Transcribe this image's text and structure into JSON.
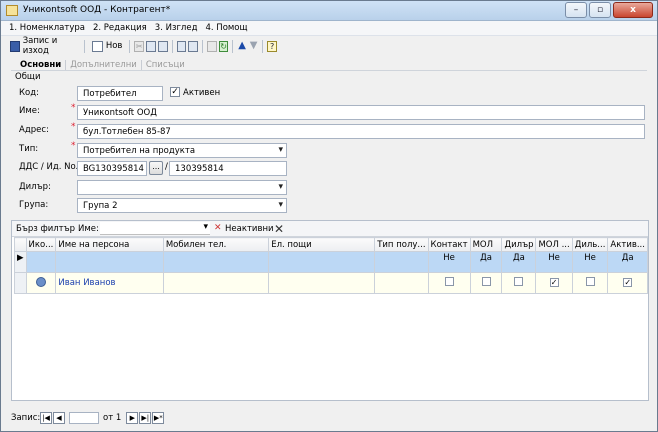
{
  "window": {
    "title": "Уникontsoft ООД - Контрагент*",
    "controls": [
      "–",
      "▫",
      "x"
    ]
  },
  "menu": [
    "1. Номенклатура",
    "2. Редакция",
    "3. Изглед",
    "4. Помощ"
  ],
  "toolbar": {
    "save_label": "Запис и изход",
    "new_label": "Нов"
  },
  "tabs": [
    "Основни",
    "Допълнителни",
    "Списъци"
  ],
  "section": "Общи",
  "form": {
    "code_label": "Код:",
    "code_value": "Потребител",
    "active_label": "Активен",
    "name_label": "Име:",
    "name_value": "Уникontsoft ООД",
    "address_label": "Адрес:",
    "address_value": "бул.Тотлебен 85-87",
    "type_label": "Тип:",
    "type_value": "Потребител на продукта",
    "vat_label": "ДДС / Ид. No.",
    "vat_value": "BG130395814",
    "dots": "...",
    "slash": "/",
    "id_value": "130395814",
    "dealer_label": "Дилър:",
    "dealer_value": "",
    "group_label": "Група:",
    "group_value": "Група 2"
  },
  "filterbar": {
    "quick_filter": "Бърз филтър",
    "name_label": "Име:",
    "inactive_label": "Неактивни"
  },
  "grid": {
    "columns": [
      "Ико...",
      "Име на персона",
      "Мобилен тел.",
      "Ел. пощи",
      "Тип полу...",
      "Контакт",
      "МОЛ",
      "Дилър",
      "МОЛ ...",
      "Диль...",
      "Актив..."
    ],
    "filter_values": [
      "Не",
      "Да",
      "Да",
      "Не",
      "Не",
      "Да"
    ],
    "rows": [
      {
        "name": "Иван Иванов",
        "mobile": "",
        "email": "",
        "type": "",
        "checks": [
          false,
          false,
          false,
          true,
          false,
          true
        ]
      }
    ]
  },
  "status": {
    "record_label": "Запис:",
    "of_label": "от 1",
    "nav": [
      "|◀",
      "◀",
      "▶",
      "▶|",
      "▶*"
    ]
  }
}
